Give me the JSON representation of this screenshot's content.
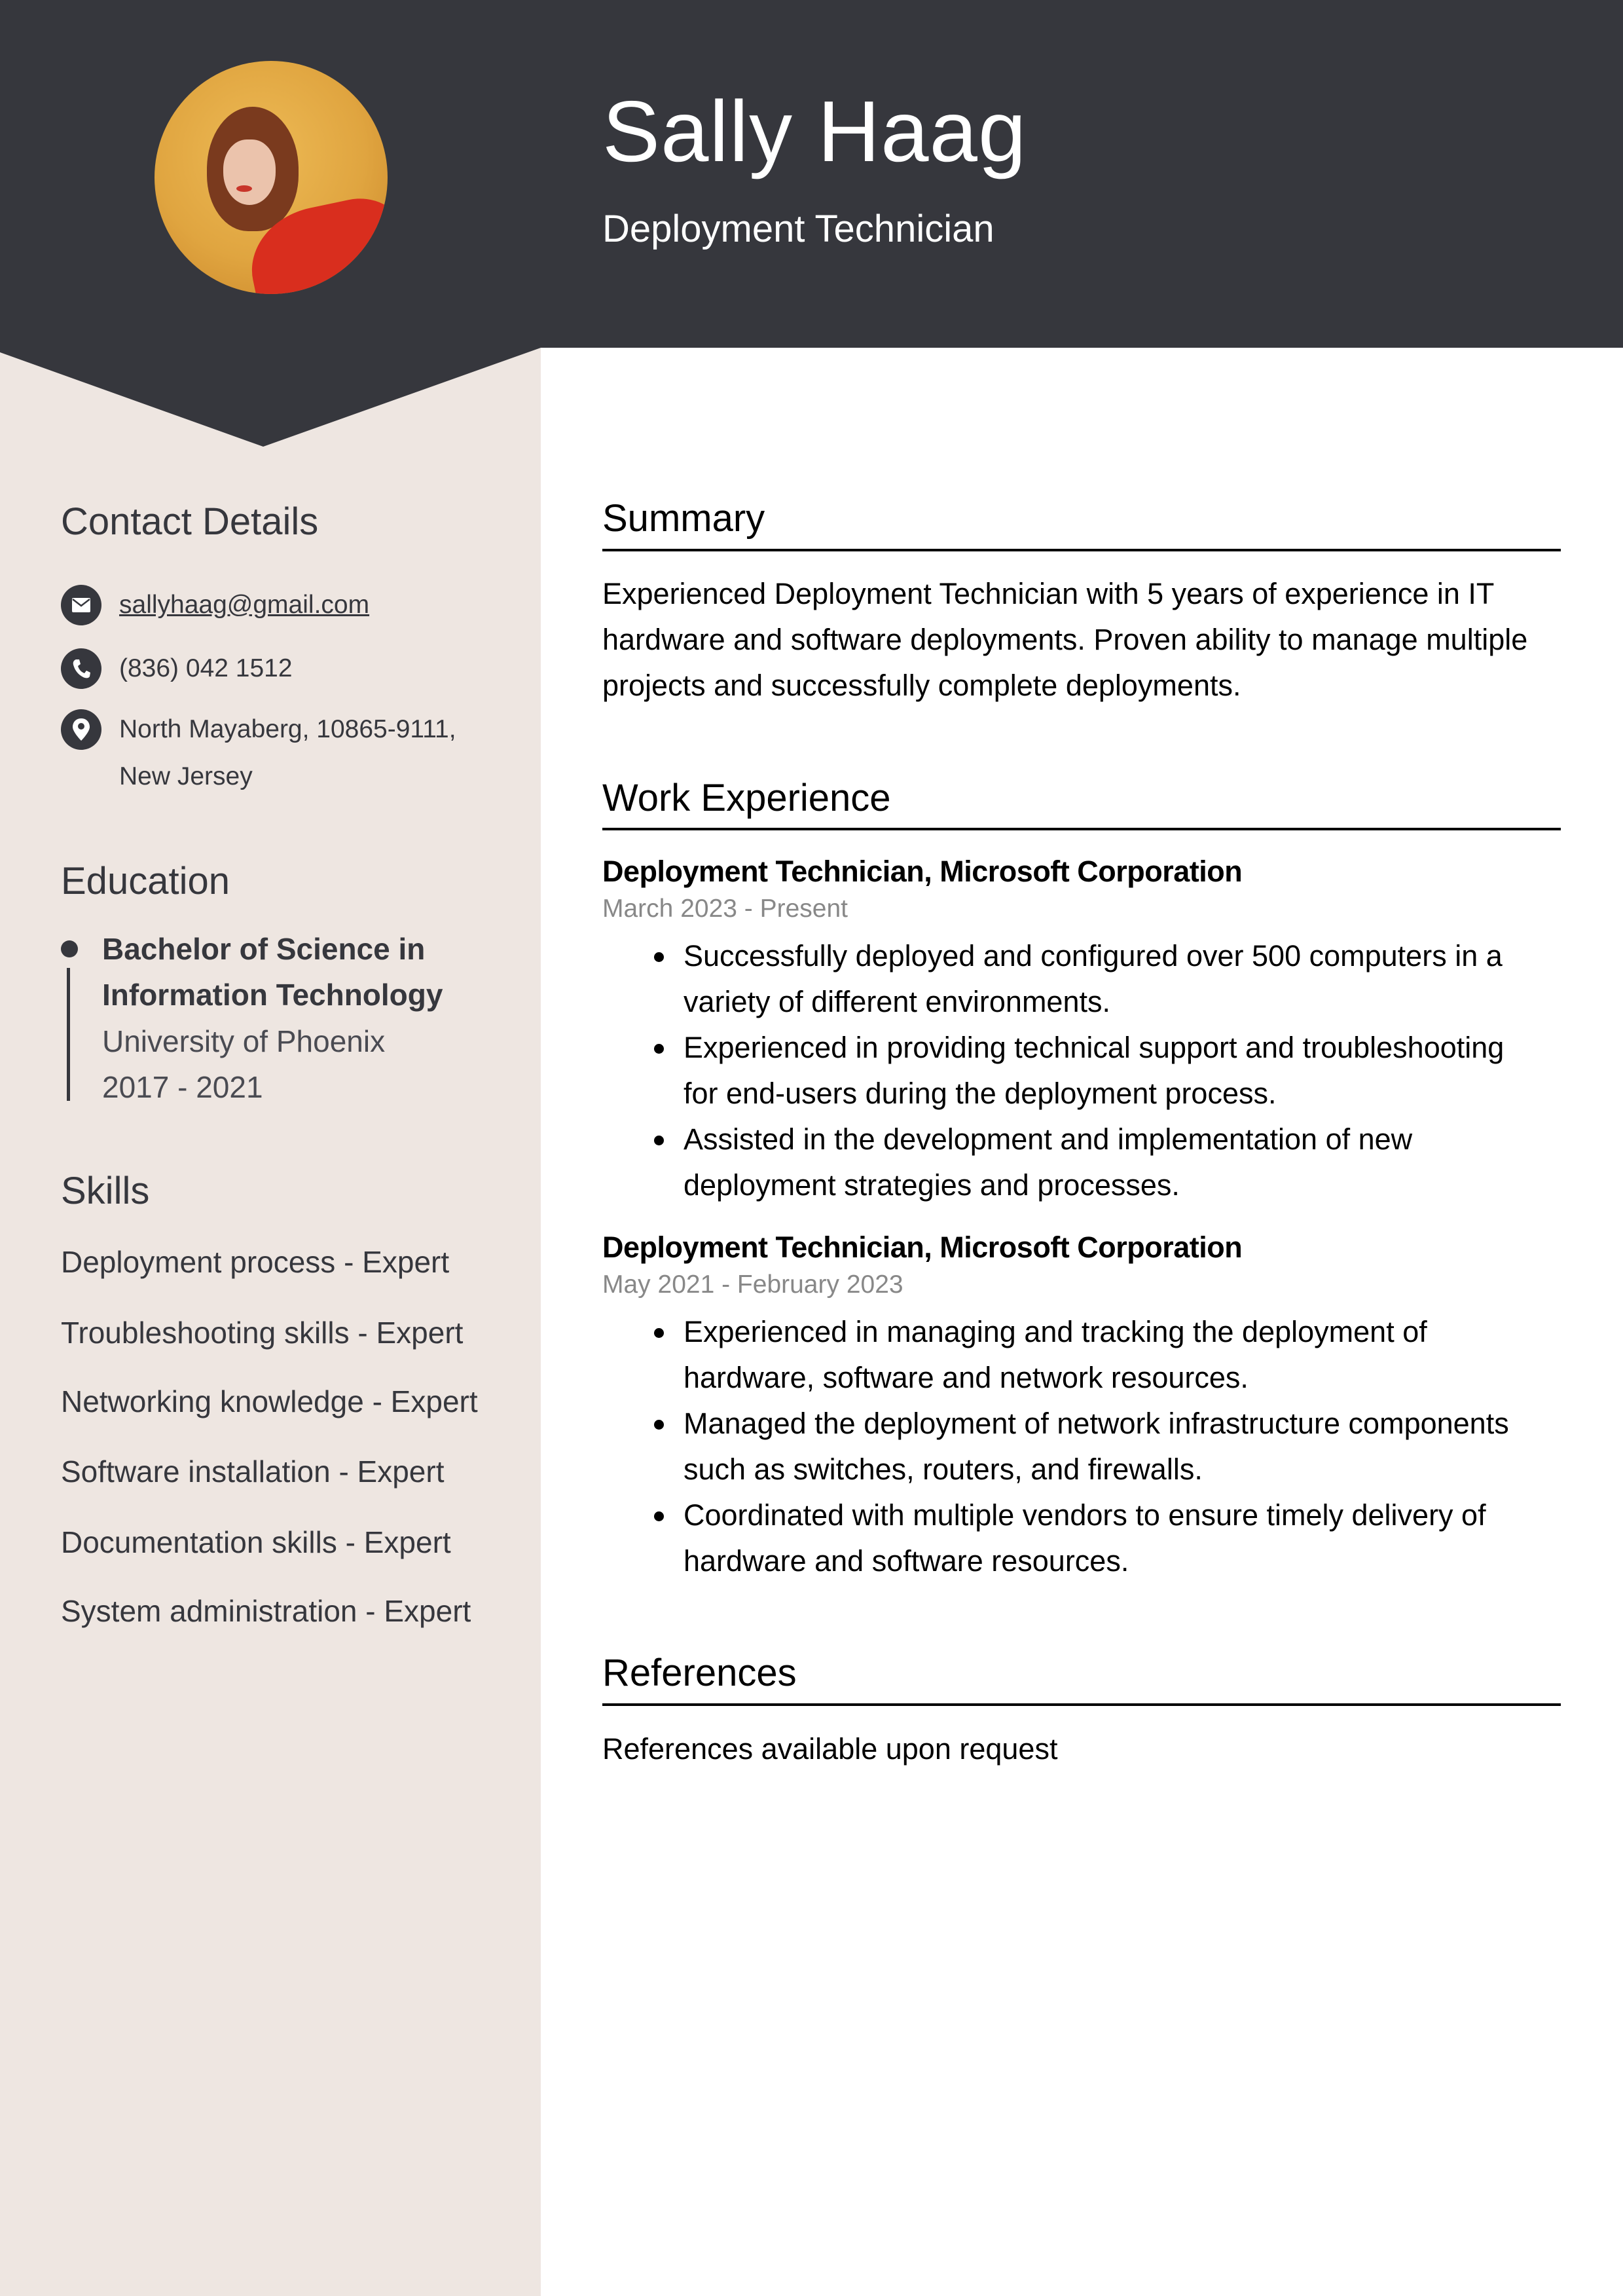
{
  "header": {
    "name": "Sally Haag",
    "job_title": "Deployment Technician",
    "photo_alt": "profile-photo"
  },
  "colors": {
    "header_dark": "#36373D",
    "sidebar_bg": "#EEE6E1",
    "date_gray": "#888888"
  },
  "sidebar": {
    "contact": {
      "heading": "Contact Details",
      "email": "sallyhaag@gmail.com",
      "phone": "(836) 042 1512",
      "address_line1": "North Mayaberg, 10865-9111,",
      "address_line2": "New Jersey",
      "icons": [
        "envelope-icon",
        "phone-icon",
        "location-pin-icon"
      ]
    },
    "education": {
      "heading": "Education",
      "degree_line1": "Bachelor of Science in",
      "degree_line2": "Information Technology",
      "school": "University of Phoenix",
      "years": "2017 - 2021"
    },
    "skills": {
      "heading": "Skills",
      "items": [
        "Deployment process - Expert",
        "Troubleshooting skills - Expert",
        "Networking knowledge - Expert",
        "Software installation - Expert",
        "Documentation skills - Expert",
        "System administration - Expert"
      ]
    }
  },
  "main": {
    "summary": {
      "heading": "Summary",
      "lines": [
        "Experienced Deployment Technician with 5 years of experience in IT",
        "hardware and software deployments. Proven ability to manage multiple",
        "projects and successfully complete deployments."
      ]
    },
    "work": {
      "heading": "Work Experience",
      "jobs": [
        {
          "title": "Deployment Technician, Microsoft Corporation",
          "dates": "March 2023 - Present",
          "bullets": [
            [
              "Successfully deployed and configured over 500 computers in a",
              "variety of different environments."
            ],
            [
              "Experienced in providing technical support and troubleshooting",
              "for end-users during the deployment process."
            ],
            [
              "Assisted in the development and implementation of new",
              "deployment strategies and processes."
            ]
          ]
        },
        {
          "title": "Deployment Technician, Microsoft Corporation",
          "dates": "May 2021 - February 2023",
          "bullets": [
            [
              "Experienced in managing and tracking the deployment of",
              "hardware, software and network resources."
            ],
            [
              "Managed the deployment of network infrastructure components",
              "such as switches, routers, and firewalls."
            ],
            [
              "Coordinated with multiple vendors to ensure timely delivery of",
              "hardware and software resources."
            ]
          ]
        }
      ]
    },
    "references": {
      "heading": "References",
      "text": "References available upon request"
    }
  }
}
